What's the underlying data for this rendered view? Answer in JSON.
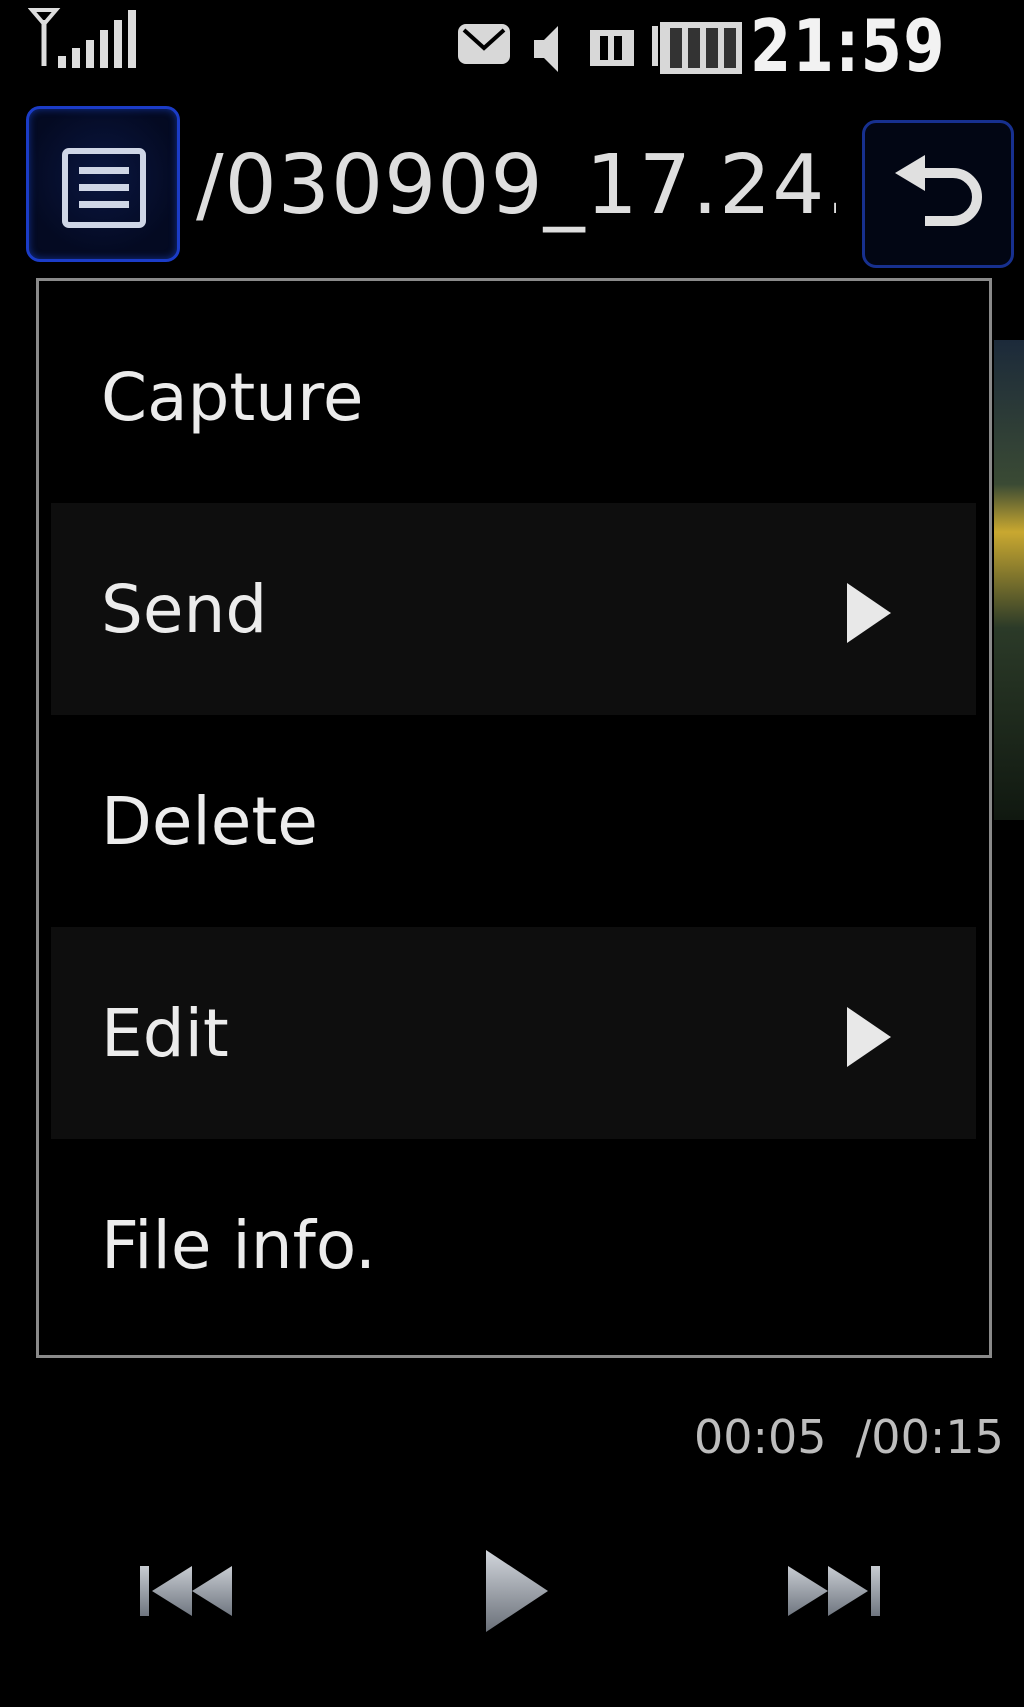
{
  "status": {
    "time": "21:59",
    "icons": [
      "signal-icon",
      "message-icon",
      "speaker-icon",
      "memory-card-icon",
      "battery-icon"
    ]
  },
  "header": {
    "title": "/030909_17.24.",
    "menu_icon": "menu-list-icon",
    "back_icon": "back-arrow-icon"
  },
  "menu": {
    "items": [
      {
        "label": "Capture",
        "submenu": false
      },
      {
        "label": "Send",
        "submenu": true
      },
      {
        "label": "Delete",
        "submenu": false
      },
      {
        "label": "Edit",
        "submenu": true
      },
      {
        "label": "File info.",
        "submenu": false
      }
    ]
  },
  "player": {
    "time_readout": "00:05  /00:15",
    "controls": [
      "previous-icon",
      "play-icon",
      "next-icon"
    ]
  },
  "colors": {
    "accent_blue": "#1b3cc7",
    "menu_border": "#8a8a8a",
    "text": "#ececec"
  }
}
